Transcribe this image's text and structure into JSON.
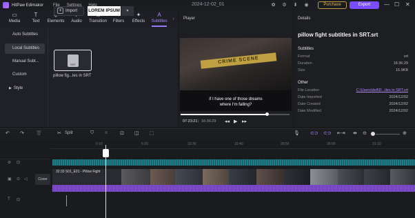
{
  "app": {
    "name": "HitPaw Edimakor",
    "menu": [
      "File",
      "Settings",
      "Help"
    ],
    "date": "2024-12-02_01",
    "purchase_label": "Purchase",
    "export_label": "Export"
  },
  "toolbar": {
    "tools": [
      {
        "label": "Media",
        "icon": "T"
      },
      {
        "label": "Text",
        "icon": "T"
      },
      {
        "label": "Elements",
        "icon": "◈"
      },
      {
        "label": "Audio",
        "icon": "♪"
      },
      {
        "label": "Transition",
        "icon": "⧉"
      },
      {
        "label": "Filters",
        "icon": "◐"
      },
      {
        "label": "Effects",
        "icon": "✦"
      },
      {
        "label": "Subtitles",
        "icon": "A"
      }
    ],
    "active": "Subtitles",
    "more": "›"
  },
  "sidebar": {
    "items": [
      "Auto Subtitles",
      "Local Subtitles",
      "Manual Subt...",
      "Custom",
      "Style"
    ],
    "selected": "Local Subtitles"
  },
  "media": {
    "import_label": "Import",
    "import_icon": "+",
    "font_preview": "LOREM IPSUM",
    "font_dropdown": "▾",
    "file_icon_text": "SRT",
    "file_label": "pillow fig...les in SRT"
  },
  "player": {
    "title": "Player",
    "scene_text": "CRIME SCENE",
    "subtitle_line1": "if I have one of those dreams",
    "subtitle_line2": "where I'm falling?",
    "current_time": "07:23:21",
    "total_time": "16:36:29",
    "progress": 0.79,
    "controls": [
      "◂◂",
      "▶",
      "▸▸"
    ]
  },
  "details": {
    "title": "Details",
    "filename": "pillow fight subtitles in SRT.srt",
    "subtitles_header": "Subtitles",
    "subtitles": [
      {
        "key": "Format",
        "value": "srt"
      },
      {
        "key": "Duration",
        "value": "16:36:29"
      },
      {
        "key": "Size",
        "value": "15.9KB"
      }
    ],
    "other_header": "Other",
    "other": [
      {
        "key": "File Location",
        "value": "C:\\Users\\dell\\D...tles in SRT.srt"
      },
      {
        "key": "Date Imported",
        "value": "2024/12/02"
      },
      {
        "key": "Date Created",
        "value": "2024/12/02"
      },
      {
        "key": "Date Modified",
        "value": "2024/12/02"
      }
    ]
  },
  "timeline_toolbar": {
    "split_label": "Split",
    "icons": [
      "undo-icon",
      "redo-icon",
      "delete-icon",
      "split-icon",
      "marker-icon",
      "crop-icon",
      "text-icon",
      "speed-icon",
      "ai-icon",
      "mic-icon",
      "link-icon",
      "magnet-icon",
      "zoom-out-icon",
      "zoom-in-icon"
    ]
  },
  "timeline": {
    "ruler_labels": [
      "0:10",
      "5:20",
      "10:30",
      "15:40",
      "20:50",
      "26:00",
      "31:10"
    ],
    "clip_label": "32:33  S01_E01 - Pillow Fight",
    "cover_label": "Cover"
  }
}
